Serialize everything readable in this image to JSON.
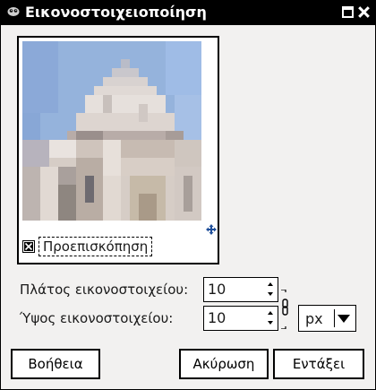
{
  "window": {
    "title": "Εικονοστοιχειοποίηση",
    "app_icon": "gimp-icon",
    "controls": [
      "maximize-icon",
      "close-icon"
    ]
  },
  "preview": {
    "checkbox_label": "Προεπισκόπηση",
    "checked": true
  },
  "fields": {
    "width_label": "Πλάτος εικονοστοιχείου:",
    "width_value": "10",
    "height_label": "Ύψος εικονοστοιχείου:",
    "height_value": "10",
    "unit": "px"
  },
  "buttons": {
    "help": "Βοήθεια",
    "cancel": "Ακύρωση",
    "ok": "Εντάξει"
  }
}
